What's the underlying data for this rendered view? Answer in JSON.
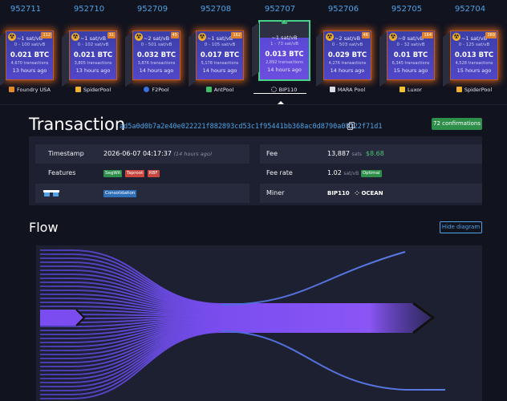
{
  "blocks": [
    {
      "height": "952711",
      "fee_median": "~1 sat/vB",
      "fee_range": "0 - 100 sat/vB",
      "total": "0.021 BTC",
      "tx_count": "4,670 transactions",
      "ago": "13 hours ago",
      "badge": "112",
      "pool": "Foundry USA"
    },
    {
      "height": "952710",
      "fee_median": "~1 sat/vB",
      "fee_range": "0 - 102 sat/vB",
      "total": "0.021 BTC",
      "tx_count": "3,805 transactions",
      "ago": "13 hours ago",
      "badge": "31",
      "pool": "SpiderPool"
    },
    {
      "height": "952709",
      "fee_median": "~2 sat/vB",
      "fee_range": "0 - 501 sat/vB",
      "total": "0.032 BTC",
      "tx_count": "3,876 transactions",
      "ago": "14 hours ago",
      "badge": "45",
      "pool": "F2Pool"
    },
    {
      "height": "952708",
      "fee_median": "~1 sat/vB",
      "fee_range": "0 - 105 sat/vB",
      "total": "0.017 BTC",
      "tx_count": "5,178 transactions",
      "ago": "14 hours ago",
      "badge": "162",
      "pool": "AntPool"
    },
    {
      "height": "952707",
      "fee_median": "~1 sat/vB",
      "fee_range": "1 - 73 sat/vB",
      "total": "0.013 BTC",
      "tx_count": "2,892 transactions",
      "ago": "14 hours ago",
      "badge": "",
      "pool": "BIP110",
      "selected": true
    },
    {
      "height": "952706",
      "fee_median": "~2 sat/vB",
      "fee_range": "0 - 503 sat/vB",
      "total": "0.029 BTC",
      "tx_count": "4,276 transactions",
      "ago": "14 hours ago",
      "badge": "46",
      "pool": "MARA Pool"
    },
    {
      "height": "952705",
      "fee_median": "~0 sat/vB",
      "fee_range": "0 - 32 sat/vB",
      "total": "0.01 BTC",
      "tx_count": "6,345 transactions",
      "ago": "15 hours ago",
      "badge": "164",
      "pool": "Luxor"
    },
    {
      "height": "952704",
      "fee_median": "~1 sat/vB",
      "fee_range": "0 - 125 sat/vB",
      "total": "0.013 BTC",
      "tx_count": "4,528 transactions",
      "ago": "15 hours ago",
      "badge": "369",
      "pool": "SpiderPool"
    }
  ],
  "transaction": {
    "title": "Transaction",
    "txid": "ad5a0d0b7a2e40e022221f882893cd53c1f95441bb368ac0d8790a08122f71d1",
    "confirmations": "72 confirmations"
  },
  "details": {
    "timestamp_label": "Timestamp",
    "timestamp_value": "2026-06-07 04:17:37",
    "timestamp_relative": "(14 hours ago)",
    "features_label": "Features",
    "features": [
      "SegWit",
      "Taproot",
      "RBF"
    ],
    "consolidation_tag": "Consolidation",
    "fee_label": "Fee",
    "fee_sats": "13,887",
    "fee_unit": "sats",
    "fee_usd": "$8.68",
    "fee_rate_label": "Fee rate",
    "fee_rate_value": "1.02",
    "fee_rate_unit": "sat/vB",
    "fee_rate_tag": "Optimal",
    "miner_label": "Miner",
    "miner_value": "BIP110",
    "miner_secondary": "OCEAN"
  },
  "flow": {
    "title": "Flow",
    "hide_button": "Hide diagram"
  },
  "colors": {
    "accent_blue": "#4fa3e6",
    "block_glow": "#f06e1e",
    "selected_border": "#48d28a",
    "flow_purple": "#7b4df0"
  }
}
